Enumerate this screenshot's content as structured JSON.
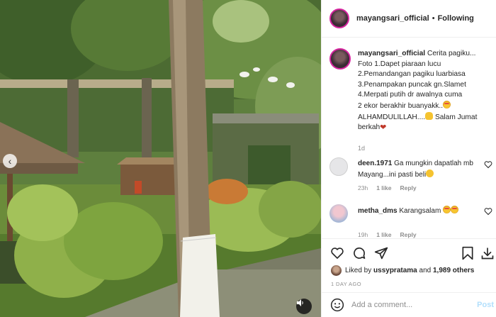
{
  "post": {
    "username": "mayangsari_official",
    "follow_label": "Following",
    "caption_lines": [
      "Cerita pagiku...",
      "Foto 1.Dapet piaraan lucu",
      "2.Pemandangan pagiku luarbiasa",
      "3.Penampakan puncak gn.Slamet",
      "4.Merpati putih dr awalnya cuma",
      "2 ekor berakhir buanyakk..",
      "ALHAMDULILLAH....",
      " Salam Jumat",
      "berkah"
    ],
    "caption_time": "1d"
  },
  "comments": [
    {
      "username": "deen.1971",
      "text": "Ga mungkin dapatlah mb Mayang...ini pasti beli",
      "time": "23h",
      "likes": "1 like",
      "reply": "Reply",
      "avatar_color": "#e9e9ea"
    },
    {
      "username": "metha_dms",
      "text": "Karangsalam",
      "time": "19h",
      "likes": "1 like",
      "reply": "Reply",
      "avatar_color": "#f4c6cf"
    }
  ],
  "engagement": {
    "liked_by_prefix": "Liked by",
    "liked_by_user": "ussypratama",
    "and": "and",
    "others": "1,989 others",
    "posted": "1 DAY AGO"
  },
  "composer": {
    "placeholder": "Add a comment...",
    "post_label": "Post"
  },
  "icons": [
    "heart-icon",
    "comment-icon",
    "share-icon",
    "bookmark-icon",
    "download-icon",
    "volume-icon",
    "chevron-left-icon"
  ],
  "colors": {
    "border": "#efefef",
    "muted": "#8e8e8e",
    "post_disabled": "#b2dffc",
    "story_ring": "#d6249f"
  }
}
